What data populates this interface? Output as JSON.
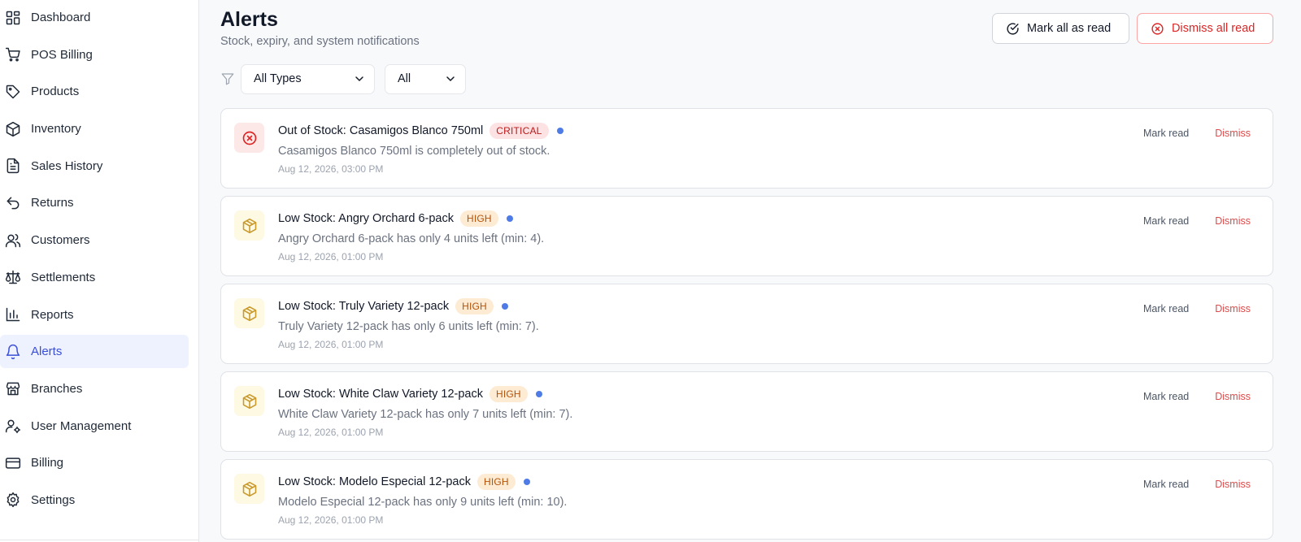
{
  "sidebar": {
    "items": [
      {
        "label": "Dashboard",
        "icon": "grid-icon"
      },
      {
        "label": "POS Billing",
        "icon": "cart-icon"
      },
      {
        "label": "Products",
        "icon": "tag-icon"
      },
      {
        "label": "Inventory",
        "icon": "box-icon"
      },
      {
        "label": "Sales History",
        "icon": "document-icon"
      },
      {
        "label": "Returns",
        "icon": "undo-icon"
      },
      {
        "label": "Customers",
        "icon": "users-icon"
      },
      {
        "label": "Settlements",
        "icon": "scale-icon"
      },
      {
        "label": "Reports",
        "icon": "bar-chart-icon"
      },
      {
        "label": "Alerts",
        "icon": "bell-icon",
        "active": true
      },
      {
        "label": "Branches",
        "icon": "store-icon"
      },
      {
        "label": "User Management",
        "icon": "user-cog-icon"
      },
      {
        "label": "Billing",
        "icon": "credit-card-icon"
      },
      {
        "label": "Settings",
        "icon": "gear-icon"
      }
    ]
  },
  "header": {
    "title": "Alerts",
    "subtitle": "Stock, expiry, and system notifications",
    "mark_all_label": "Mark all as read",
    "dismiss_all_label": "Dismiss all read"
  },
  "filters": {
    "type_value": "All Types",
    "severity_value": "All"
  },
  "alerts": [
    {
      "title": "Out of Stock: Casamigos Blanco 750ml",
      "severity": "CRITICAL",
      "message": "Casamigos Blanco 750ml is completely out of stock.",
      "time": "Aug 12, 2026, 03:00 PM"
    },
    {
      "title": "Low Stock: Angry Orchard 6-pack",
      "severity": "HIGH",
      "message": "Angry Orchard 6-pack has only 4 units left (min: 4).",
      "time": "Aug 12, 2026, 01:00 PM"
    },
    {
      "title": "Low Stock: Truly Variety 12-pack",
      "severity": "HIGH",
      "message": "Truly Variety 12-pack has only 6 units left (min: 7).",
      "time": "Aug 12, 2026, 01:00 PM"
    },
    {
      "title": "Low Stock: White Claw Variety 12-pack",
      "severity": "HIGH",
      "message": "White Claw Variety 12-pack has only 7 units left (min: 7).",
      "time": "Aug 12, 2026, 01:00 PM"
    },
    {
      "title": "Low Stock: Modelo Especial 12-pack",
      "severity": "HIGH",
      "message": "Modelo Especial 12-pack has only 9 units left (min: 10).",
      "time": "Aug 12, 2026, 01:00 PM"
    }
  ],
  "alert_actions": {
    "mark_read_label": "Mark read",
    "dismiss_label": "Dismiss"
  },
  "colors": {
    "accent": "#3b4fd8",
    "critical": "#dc2626",
    "high": "#b45309",
    "unread_dot": "#4f7be6"
  }
}
